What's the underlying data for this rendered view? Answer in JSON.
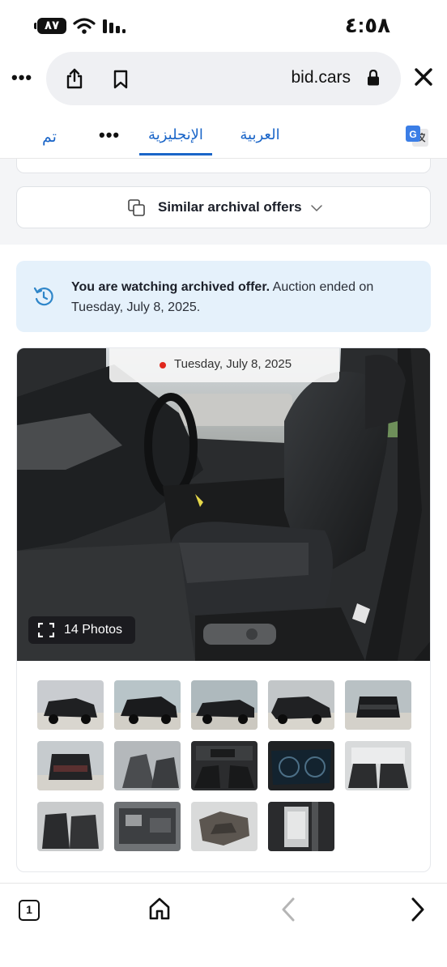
{
  "status_bar": {
    "battery": "٨٧",
    "time": "٤:٥٨"
  },
  "browser": {
    "url": "bid.cars"
  },
  "translate_bar": {
    "done": "تم",
    "lang_english": "الإنجليزية",
    "lang_arabic": "العربية"
  },
  "page": {
    "similar_offers_label": "Similar archival offers",
    "archive_notice_bold": "You are watching archived offer.",
    "archive_notice_rest": " Auction ended on Tuesday, July 8, 2025.",
    "photo_date": "Tuesday, July 8, 2025",
    "photo_count_label": "14 Photos"
  },
  "toolbar": {
    "tabs_count": "1"
  },
  "colors": {
    "accent_blue": "#1a65c8",
    "notice_bg": "#e5f1fb",
    "record_dot": "#e0281e"
  },
  "thumbnails": [
    {
      "name": "front-left-exterior"
    },
    {
      "name": "front-left-exterior-2"
    },
    {
      "name": "left-side-exterior"
    },
    {
      "name": "right-front-exterior"
    },
    {
      "name": "front-exterior"
    },
    {
      "name": "rear-exterior"
    },
    {
      "name": "rear-seats"
    },
    {
      "name": "dashboard"
    },
    {
      "name": "instrument-cluster"
    },
    {
      "name": "rear-interior"
    },
    {
      "name": "rear-seat-side"
    },
    {
      "name": "engine-bay"
    },
    {
      "name": "underbody-part"
    },
    {
      "name": "door-jamb-label"
    }
  ]
}
